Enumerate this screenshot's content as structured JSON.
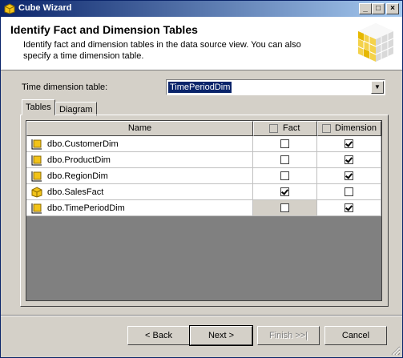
{
  "window": {
    "title": "Cube Wizard"
  },
  "header": {
    "title": "Identify Fact and Dimension Tables",
    "description": "Identify fact and dimension tables in the data source view. You can also specify a time dimension table."
  },
  "time_dimension": {
    "label": "Time dimension table:",
    "value": "TimePeriodDim"
  },
  "tabs": [
    {
      "label": "Tables",
      "active": true
    },
    {
      "label": "Diagram",
      "active": false
    }
  ],
  "grid": {
    "columns": {
      "name": "Name",
      "fact": "Fact",
      "dimension": "Dimension"
    },
    "rows": [
      {
        "name": "dbo.CustomerDim",
        "icon": "dimension-table-icon",
        "fact": false,
        "dimension": true
      },
      {
        "name": "dbo.ProductDim",
        "icon": "dimension-table-icon",
        "fact": false,
        "dimension": true
      },
      {
        "name": "dbo.RegionDim",
        "icon": "dimension-table-icon",
        "fact": false,
        "dimension": true
      },
      {
        "name": "dbo.SalesFact",
        "icon": "fact-table-icon",
        "fact": true,
        "dimension": false
      },
      {
        "name": "dbo.TimePeriodDim",
        "icon": "dimension-table-icon",
        "fact": false,
        "dimension": true
      }
    ]
  },
  "buttons": {
    "back": "< Back",
    "next": "Next >",
    "finish": "Finish >>|",
    "cancel": "Cancel"
  }
}
